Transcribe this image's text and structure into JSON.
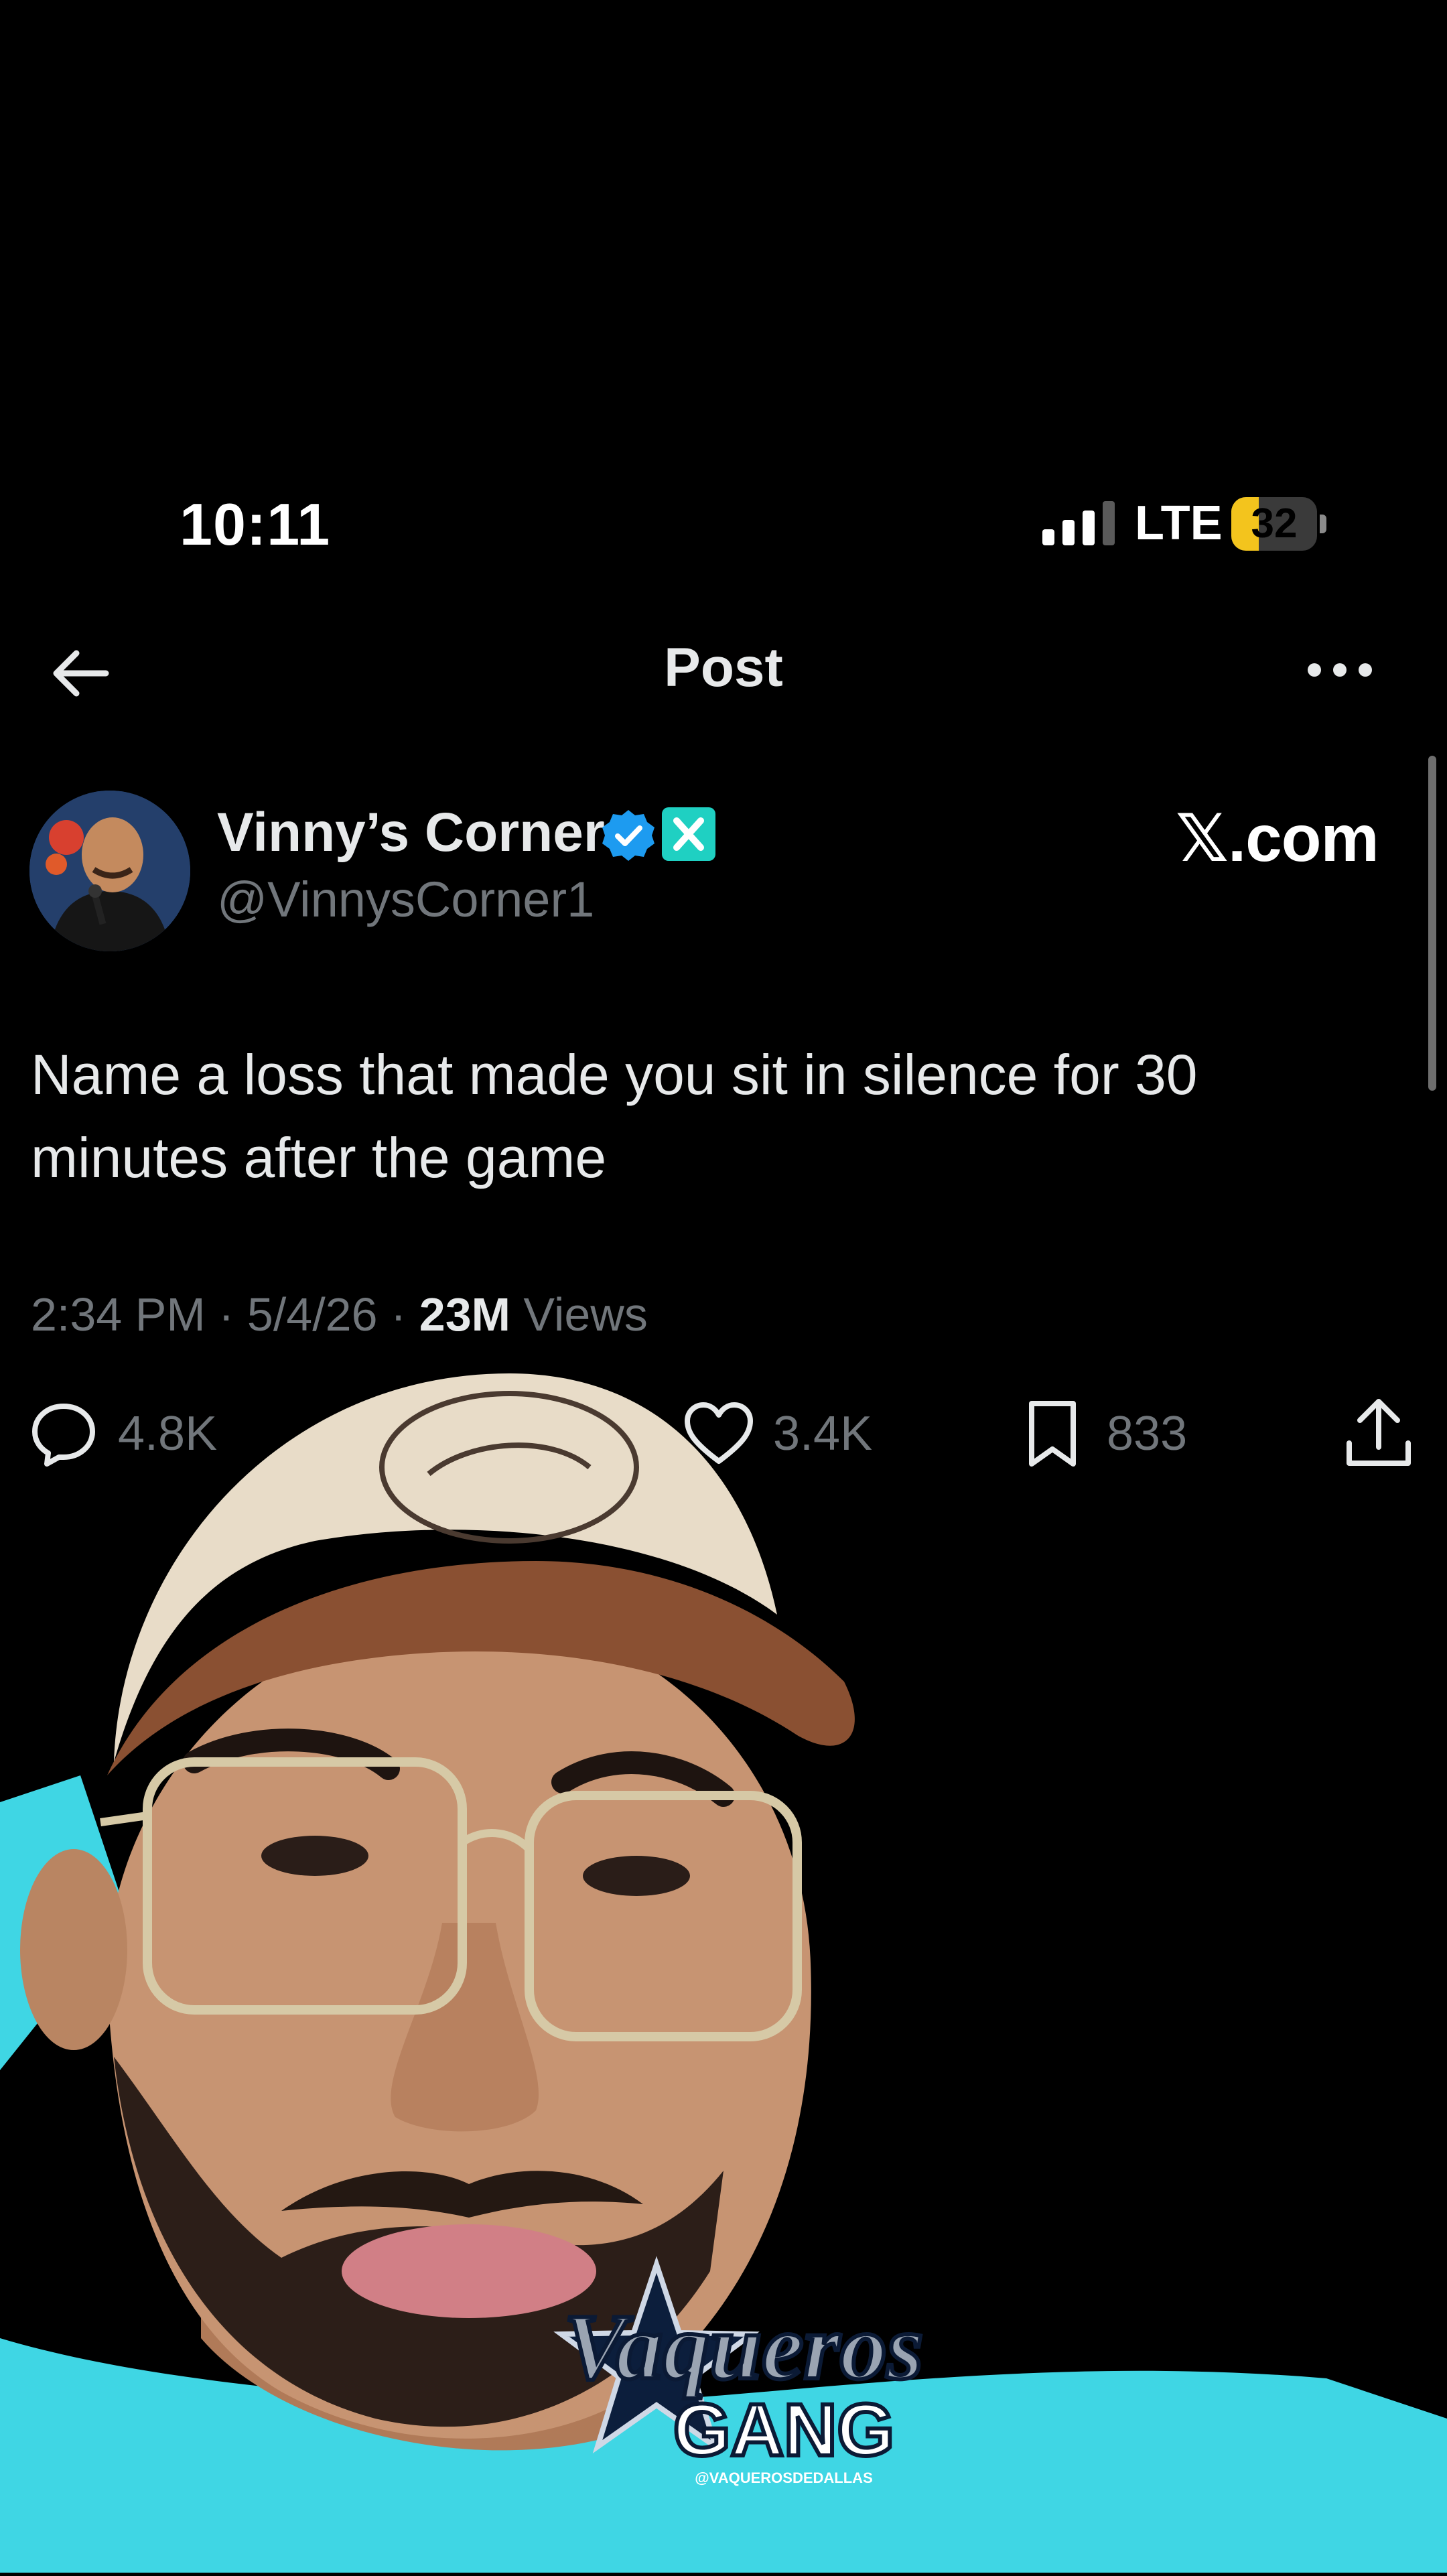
{
  "status_bar": {
    "time": "10:11",
    "network": "LTE",
    "battery_level": "32",
    "battery_fraction": 0.32,
    "signal_bars_active": 3,
    "signal_bars_total": 4
  },
  "header": {
    "title": "Post",
    "back_icon": "arrow-left-icon",
    "more_icon": "more-horizontal-icon"
  },
  "author": {
    "display_name": "Vinny’s Corner",
    "handle": "@VinnysCorner1",
    "site": "𝕏.com"
  },
  "post": {
    "text": "Name a loss that made you sit in silence for 30 minutes after the game",
    "time": "2:34 PM",
    "date": "5/4/26",
    "separator": " · ",
    "views_count": "23M",
    "views_label": "Views"
  },
  "actions": {
    "replies": "4.8K",
    "likes": "3.4K",
    "bookmarks": "833"
  },
  "overlay": {
    "watermark_line1": "Vaqueros",
    "watermark_line2": "GANG",
    "watermark_small": "@VAQUEROSDEDALLAS"
  },
  "colors": {
    "background": "#000000",
    "text_primary": "#e7e9ea",
    "text_secondary": "#71767b",
    "verified_blue": "#1d9bf0",
    "battery_yellow": "#f3c41d",
    "badge_teal": "#1fd0c2",
    "shirt_cyan": "#3fd6e4"
  }
}
